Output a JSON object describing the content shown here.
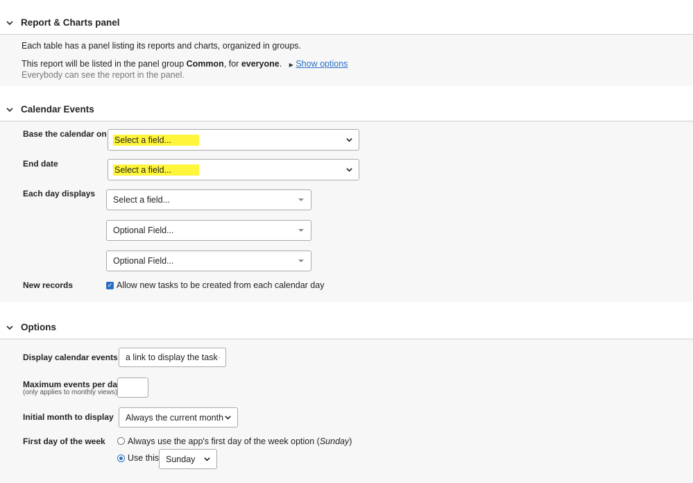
{
  "report_panel": {
    "title": "Report & Charts panel",
    "intro": "Each table has a panel listing its reports and charts, organized in groups.",
    "listed_prefix": "This report will be listed in the panel group ",
    "group_name": "Common",
    "listed_mid": ", for ",
    "audience": "everyone",
    "listed_end": ".",
    "show_options": "Show options",
    "visibility_note": "Everybody can see the report in the panel."
  },
  "calendar_events": {
    "title": "Calendar Events",
    "base_label": "Base the calendar on",
    "base_value": "Select a field...",
    "end_label": "End date",
    "end_value": "Select a field...",
    "each_day_label": "Each day displays",
    "each_day_fields": [
      "Select a field...",
      "Optional Field...",
      "Optional Field..."
    ],
    "new_records_label": "New records",
    "new_records_checkbox": "Allow new tasks to be created from each calendar day",
    "new_records_checked": true
  },
  "options": {
    "title": "Options",
    "display_label": "Display calendar events as",
    "display_value": "a link to display the task",
    "max_label": "Maximum events per day",
    "max_sub": "(only applies to monthly views)",
    "max_value": "",
    "initial_label": "Initial month to display",
    "initial_value": "Always the current month",
    "first_day_label": "First day of the week",
    "radio_app_prefix": "Always use the app's first day of the week option (",
    "radio_app_day": "Sunday",
    "radio_app_suffix": ")",
    "radio_use_label": "Use this:",
    "use_this_value": "Sunday",
    "selected_radio": "use_this"
  },
  "colors": {
    "highlight": "#fff53b",
    "accent": "#2a6fc1"
  }
}
